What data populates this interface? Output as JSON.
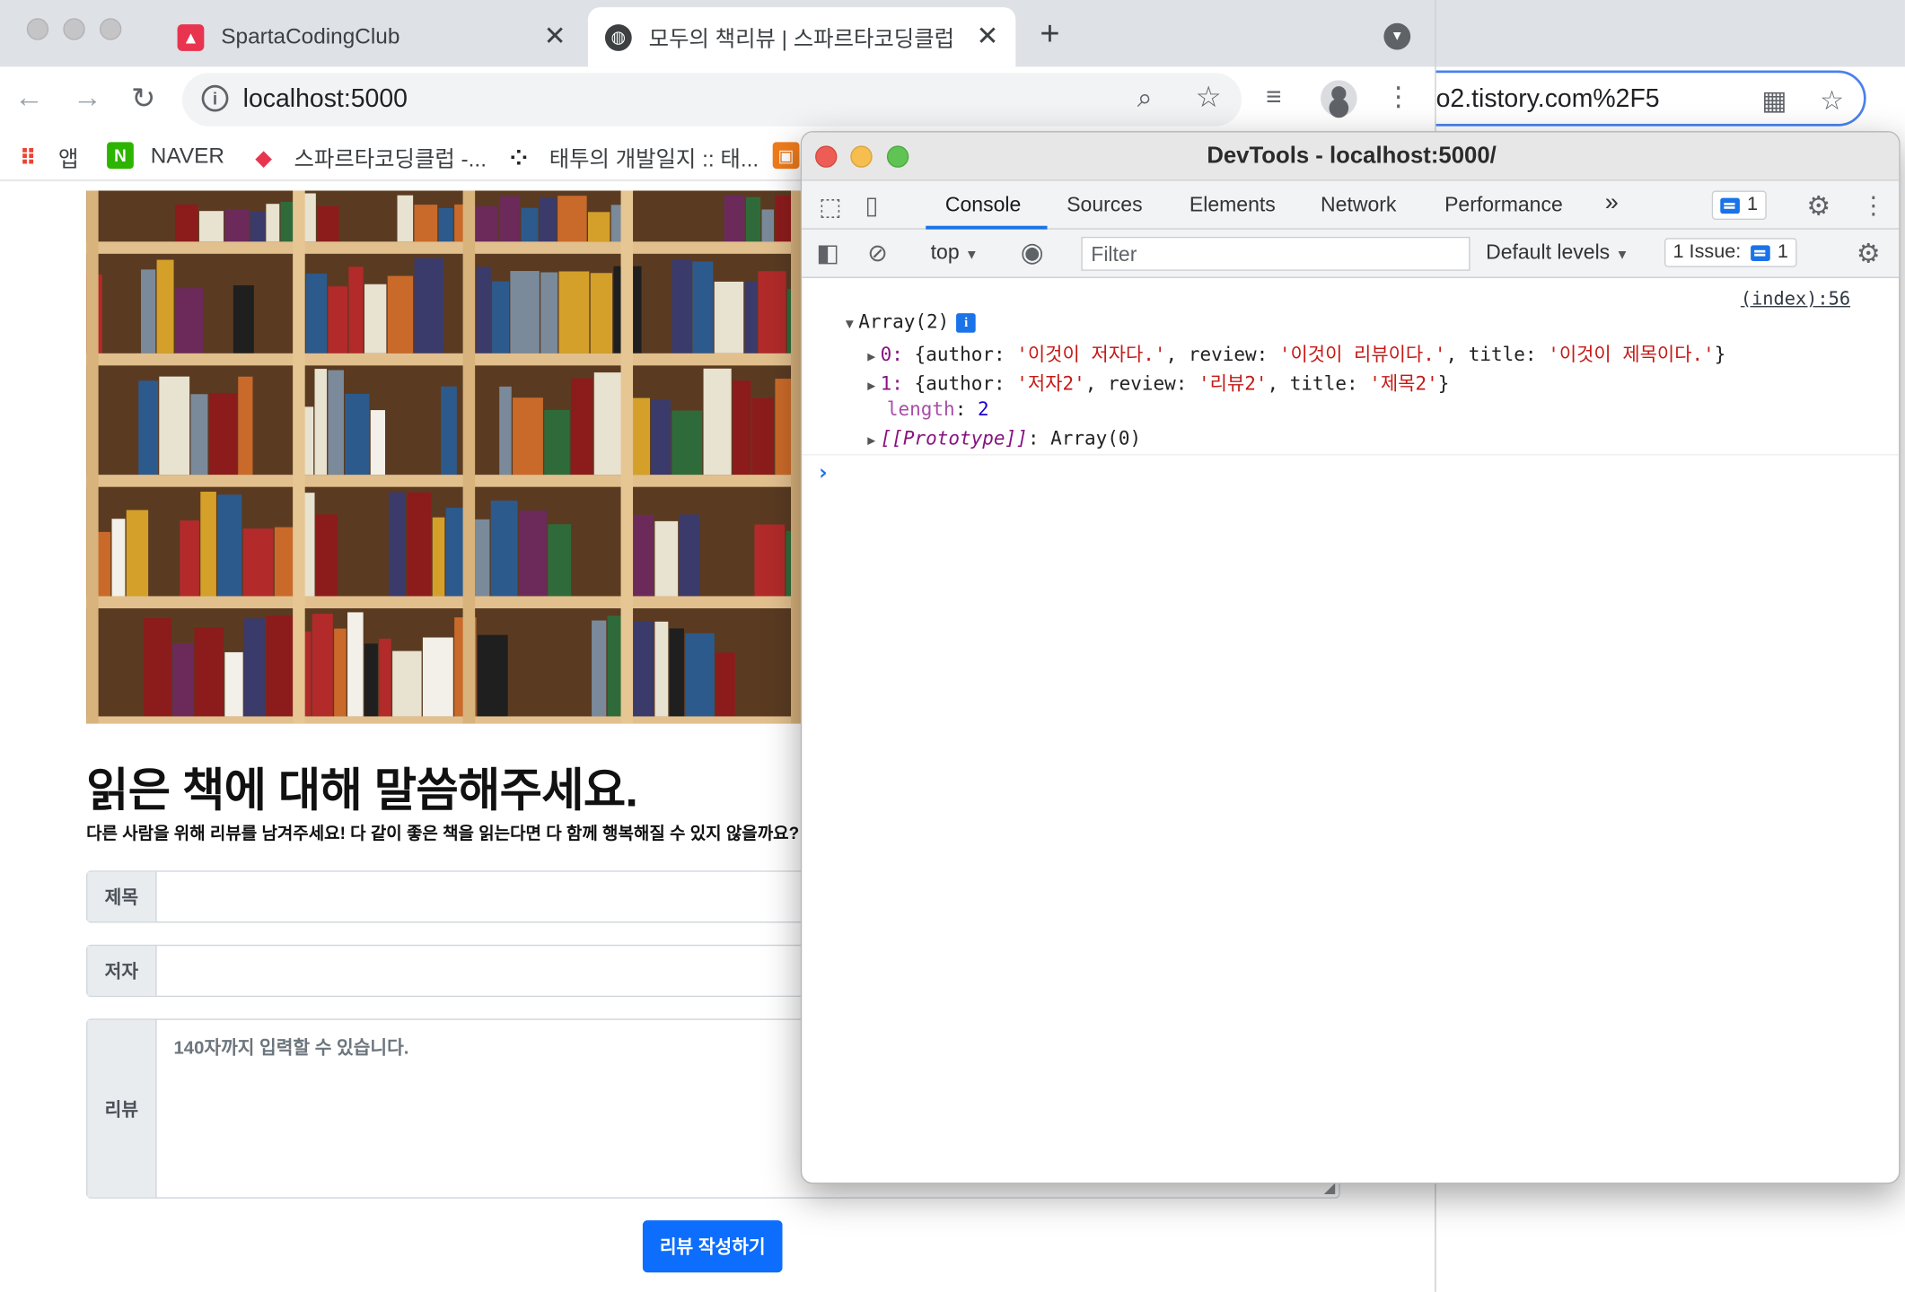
{
  "browser": {
    "tabs": [
      {
        "label": "SpartaCodingClub",
        "active": false
      },
      {
        "label": "모두의 책리뷰 | 스파르타코딩클럽",
        "active": true
      }
    ],
    "new_tab_icon": "plus-icon",
    "url": "localhost:5000",
    "background_url": "o2.tistory.com%2F5",
    "bookmarks": [
      "앱",
      "NAVER",
      "스파르타코딩클럽 -...",
      "태투의 개발일지 :: 태..."
    ]
  },
  "page": {
    "title": "읽은 책에 대해 말씀해주세요.",
    "subtitle": "다른 사람을 위해 리뷰를 남겨주세요! 다 같이 좋은 책을 읽는다면 다 함께 행복해질 수 있지 않을까요?",
    "title_label": "제목",
    "author_label": "저자",
    "review_label": "리뷰",
    "review_placeholder": "140자까지 입력할 수 있습니다.",
    "submit_label": "리뷰 작성하기",
    "accent": "#0d6efd"
  },
  "devtools": {
    "window_title": "DevTools - localhost:5000/",
    "tabs": [
      "Console",
      "Sources",
      "Elements",
      "Network",
      "Performance"
    ],
    "active_tab": "Console",
    "more_tabs": "»",
    "message_count": "1",
    "context": "top",
    "filter_placeholder": "Filter",
    "levels": "Default levels",
    "issues_label": "1 Issue:",
    "issues_count": "1",
    "source_link": "(index):56",
    "array_header": "Array(2)",
    "items": [
      {
        "index": "0",
        "author": "'이것이 저자다.'",
        "review": "'이것이 리뷰이다.'",
        "title": "'이것이 제목이다.'"
      },
      {
        "index": "1",
        "author": "'저자2'",
        "review": "'리뷰2'",
        "title": "'제목2'"
      }
    ],
    "length_key": "length",
    "length_value": "2",
    "prototype_key": "[[Prototype]]",
    "prototype_value": "Array(0)",
    "prompt": "›"
  }
}
